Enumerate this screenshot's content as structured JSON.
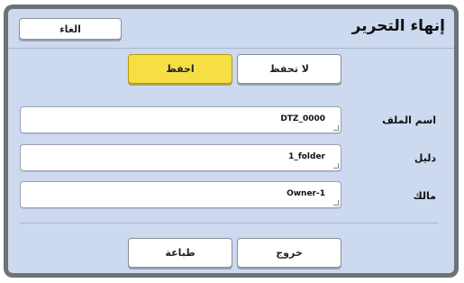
{
  "window": {
    "title": "إنهاء التحرير"
  },
  "buttons": {
    "cancel": "الغاء",
    "dont_save": "لا تحفظ",
    "save": "احفظ",
    "exit": "خروج",
    "print": "طباعة"
  },
  "fields": {
    "filename": {
      "label": "اسم الملف",
      "value": "DTZ_0000"
    },
    "directory": {
      "label": "دليل",
      "value": "1_folder"
    },
    "owner": {
      "label": "مالك",
      "value": "Owner-1"
    }
  },
  "colors": {
    "panel": "#ccd9ef",
    "accent": "#f5df45",
    "frame": "#6f7176"
  }
}
